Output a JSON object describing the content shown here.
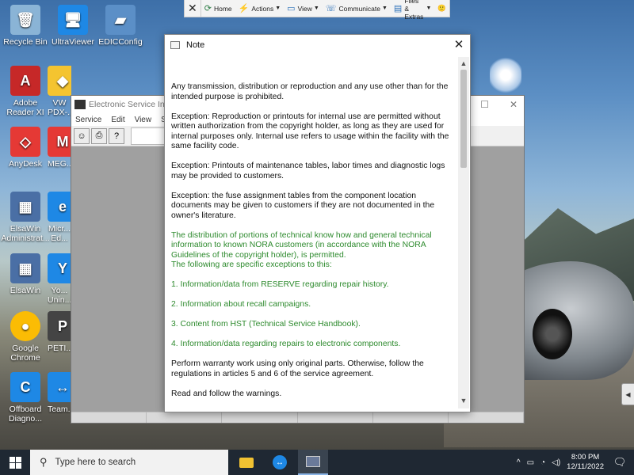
{
  "desktop": {
    "icons": [
      {
        "label": "Recycle Bin",
        "color": "#8ab4d6",
        "glyph": "🗑"
      },
      {
        "label": "UltraViewer",
        "color": "#1e88e5",
        "glyph": "🖥"
      },
      {
        "label": "EDICConfig",
        "color": "#5b8fc7",
        "glyph": "▰"
      },
      {
        "label": "Adobe Reader XI",
        "color": "#c62828",
        "glyph": "A"
      },
      {
        "label": "VW PDX-...",
        "color": "#f4c430",
        "glyph": "◆"
      },
      {
        "label": "AnyDesk",
        "color": "#e53935",
        "glyph": "◇"
      },
      {
        "label": "MEG...",
        "color": "#e53935",
        "glyph": "M"
      },
      {
        "label": "ElsaWin Administrat...",
        "color": "#4a6fa5",
        "glyph": "▦"
      },
      {
        "label": "Micr... Ed...",
        "color": "#1e88e5",
        "glyph": "e"
      },
      {
        "label": "ElsaWin",
        "color": "#4a6fa5",
        "glyph": "▦"
      },
      {
        "label": "Yo... Unin...",
        "color": "#1e88e5",
        "glyph": "Y"
      },
      {
        "label": "Google Chrome",
        "color": "#fbbc04",
        "glyph": "●"
      },
      {
        "label": "PETI...",
        "color": "#444444",
        "glyph": "P"
      },
      {
        "label": "Offboard Diagno...",
        "color": "#1e88e5",
        "glyph": "C"
      },
      {
        "label": "Team...",
        "color": "#1e88e5",
        "glyph": "↔"
      }
    ]
  },
  "remote_toolbar": {
    "close_glyph": "✕",
    "home": "Home",
    "actions": "Actions",
    "view": "View",
    "communicate": "Communicate",
    "files": "Files & Extras",
    "emoji": "🙂"
  },
  "esi_window": {
    "title": "Electronic Service Infor",
    "menu": [
      "Service",
      "Edit",
      "View",
      "Sett"
    ],
    "maximize_glyph": "☐",
    "close_glyph": "✕"
  },
  "note": {
    "title": "Note",
    "close_glyph": "✕",
    "paragraphs": [
      "Any transmission, distribution or reproduction and any use other than for the intended purpose is prohibited.",
      "Exception: Reproduction or printouts for internal use are permitted without written authorization from the copyright holder, as long as they are used for internal purposes only. Internal use refers to usage within the facility with the same facility code.",
      "Exception: Printouts of maintenance tables, labor times and diagnostic logs may be provided to customers.",
      "Exception: the fuse assignment tables from the component location documents may be given to customers if they are not documented in the owner's literature."
    ],
    "green_intro": "The distribution of portions of technical know how and general technical information to known NORA customers (in accordance with the NORA Guidelines of the copyright holder), is permitted.",
    "green_following": "The following are specific exceptions to this:",
    "green_items": [
      "1. Information/data from RESERVE regarding repair history.",
      "2. Information about recall campaigns.",
      "3. Content from HST (Technical Service Handbook).",
      "4. Information/data regarding repairs to electronic components."
    ],
    "closing": [
      "Perform warranty work using only original parts. Otherwise, follow the regulations in articles 5 and 6 of the service agreement.",
      "Read and follow the warnings."
    ],
    "colors": {
      "green": "#2d8a2d"
    }
  },
  "taskbar": {
    "search_placeholder": "Type here to search",
    "time": "8:00 PM",
    "date": "12/11/2022",
    "tray_up": "^",
    "notification_glyph": "🗨"
  }
}
